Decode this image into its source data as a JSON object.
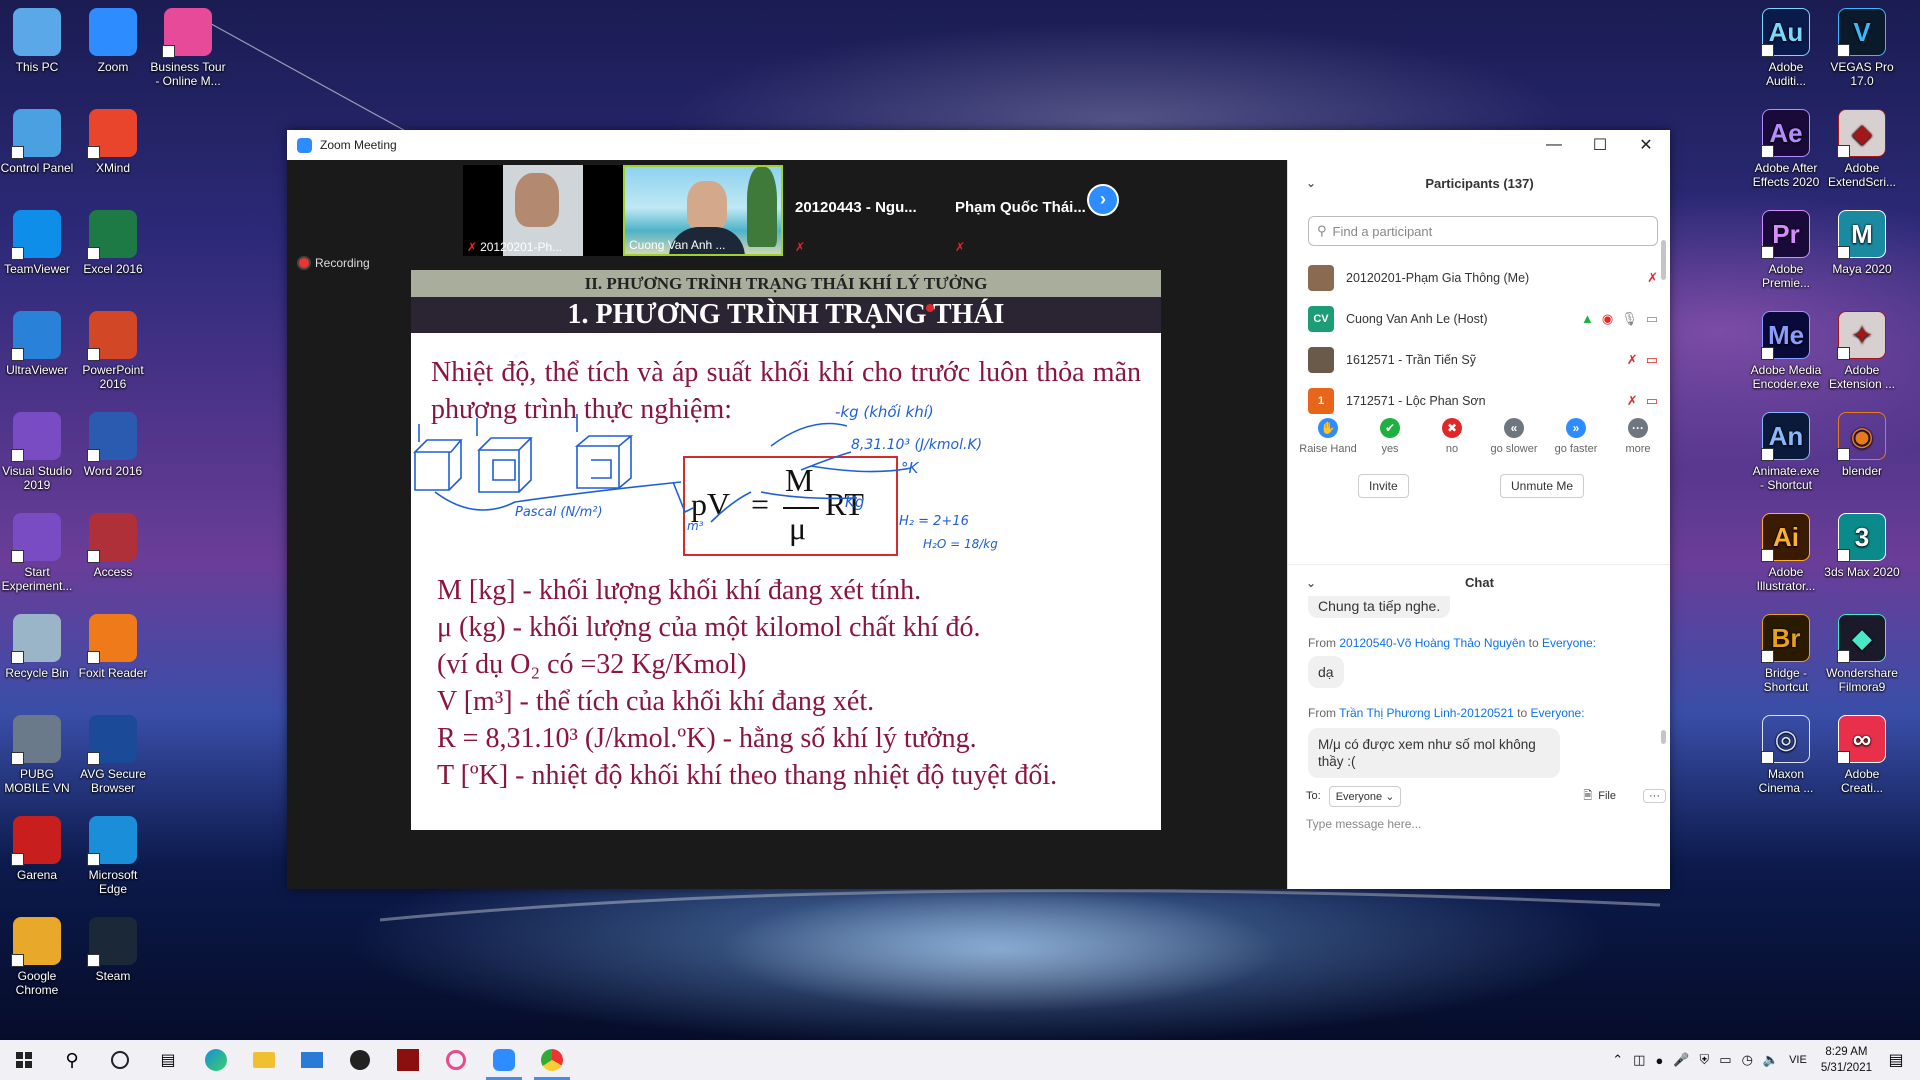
{
  "desktop": {
    "left_icons": [
      {
        "label": "This PC",
        "icon": "pc-icon",
        "color": "#5aa8e8"
      },
      {
        "label": "Zoom",
        "icon": "zoom-icon",
        "color": "#2d8cff"
      },
      {
        "label": "Business Tour\n- Online M...",
        "icon": "business-tour-icon",
        "color": "#e84a9a"
      },
      {
        "label": "Control Panel",
        "icon": "control-panel-icon",
        "color": "#4aa0e0"
      },
      {
        "label": "XMind",
        "icon": "xmind-icon",
        "color": "#e8452c"
      },
      {
        "label": "TeamViewer",
        "icon": "teamviewer-icon",
        "color": "#0e8ee9"
      },
      {
        "label": "Excel 2016",
        "icon": "excel-icon",
        "color": "#1d7a45"
      },
      {
        "label": "UltraViewer",
        "icon": "ultraviewer-icon",
        "color": "#2a82d8"
      },
      {
        "label": "PowerPoint\n2016",
        "icon": "powerpoint-icon",
        "color": "#d24726"
      },
      {
        "label": "Visual Studio\n2019",
        "icon": "visual-studio-icon",
        "color": "#7a4cc4"
      },
      {
        "label": "Word 2016",
        "icon": "word-icon",
        "color": "#2b5bb0"
      },
      {
        "label": "Start\nExperiment...",
        "icon": "visual-studio-icon",
        "color": "#7a4cc4"
      },
      {
        "label": "Access",
        "icon": "access-icon",
        "color": "#b0303a"
      },
      {
        "label": "Recycle Bin",
        "icon": "recycle-bin-icon",
        "color": "#9ab4c8"
      },
      {
        "label": "Foxit Reader",
        "icon": "foxit-icon",
        "color": "#ef7a1a"
      },
      {
        "label": "PUBG\nMOBILE VN",
        "icon": "pubg-icon",
        "color": "#6a7a8a"
      },
      {
        "label": "AVG Secure\nBrowser",
        "icon": "avg-icon",
        "color": "#1a4a98"
      },
      {
        "label": "Garena",
        "icon": "garena-icon",
        "color": "#c81e1e"
      },
      {
        "label": "Microsoft\nEdge",
        "icon": "edge-icon",
        "color": "#1a8ed8"
      },
      {
        "label": "Google\nChrome",
        "icon": "chrome-icon",
        "color": "#e8a82a"
      },
      {
        "label": "Steam",
        "icon": "steam-icon",
        "color": "#1b2838"
      }
    ],
    "right_icons": [
      {
        "label": "Adobe\nAuditi...",
        "glyph": "Au",
        "color": "#0a1a4a",
        "fg": "#7ad8ff"
      },
      {
        "label": "VEGAS Pro\n17.0",
        "glyph": "V",
        "color": "#0a1a2a",
        "fg": "#3ab8ff"
      },
      {
        "label": "Adobe After\nEffects 2020",
        "glyph": "Ae",
        "color": "#1a0a3a",
        "fg": "#b48cff"
      },
      {
        "label": "Adobe\nExtendScri...",
        "glyph": "◆",
        "color": "#d8d0d0",
        "fg": "#a01818"
      },
      {
        "label": "Adobe\nPremie...",
        "glyph": "Pr",
        "color": "#1a0a3a",
        "fg": "#d48cff"
      },
      {
        "label": "Maya 2020",
        "glyph": "M",
        "color": "#1a8aa0",
        "fg": "#ffffff"
      },
      {
        "label": "Adobe Media\nEncoder.exe",
        "glyph": "Me",
        "color": "#0a0a3a",
        "fg": "#8a9cff"
      },
      {
        "label": "Adobe\nExtension ...",
        "glyph": "✦",
        "color": "#d8d0d0",
        "fg": "#a01818"
      },
      {
        "label": "Animate.exe\n- Shortcut",
        "glyph": "An",
        "color": "#0a1a3a",
        "fg": "#8ab8ff"
      },
      {
        "label": "blender",
        "glyph": "◉",
        "color": "transparent",
        "fg": "#e87a1a"
      },
      {
        "label": "Adobe\nIllustrator...",
        "glyph": "Ai",
        "color": "#3a1a00",
        "fg": "#ffb02a"
      },
      {
        "label": "3ds Max 2020",
        "glyph": "3",
        "color": "#0a8a8a",
        "fg": "#ffffff"
      },
      {
        "label": "Bridge -\nShortcut",
        "glyph": "Br",
        "color": "#2a1a00",
        "fg": "#e8a01a"
      },
      {
        "label": "Wondershare\nFilmora9",
        "glyph": "◆",
        "color": "#1a1a2a",
        "fg": "#4ae8c8"
      },
      {
        "label": "Maxon\nCinema ...",
        "glyph": "◎",
        "color": "transparent",
        "fg": "#dde4f0"
      },
      {
        "label": "Adobe\nCreati...",
        "glyph": "∞",
        "color": "#e8304a",
        "fg": "#ffffff"
      }
    ]
  },
  "window": {
    "title": "Zoom Meeting",
    "recording": "Recording"
  },
  "gallery": {
    "tiles": [
      {
        "name": "20120201-Ph...",
        "muted": true
      },
      {
        "name": "Cuong Van Anh ...",
        "muted": false
      }
    ],
    "name_tiles": [
      {
        "name": "20120443 - Ngu...",
        "muted": true
      },
      {
        "name": "Phạm Quốc Thái...",
        "muted": true
      }
    ]
  },
  "slide": {
    "section": "II. PHƯƠNG TRÌNH TRẠNG THÁI KHÍ LÝ TƯỞNG",
    "heading": "1. PHƯƠNG TRÌNH TRẠNG THÁI",
    "intro": "Nhiệt độ, thể tích và áp suất khối khí cho trước luôn thỏa mãn phương trình thực nghiệm:",
    "formula": {
      "lhs": "pV",
      "eq": "=",
      "num": "M",
      "den": "μ",
      "rhs": "RT"
    },
    "lines": [
      "M [kg] - khối lượng khối khí đang xét tính.",
      "μ (kg)  - khối lượng của một kilomol chất khí đó.",
      "(ví dụ O₂ có =32 Kg/Kmol)",
      "V [m³] - thể tích của khối khí đang xét.",
      "R = 8,31.10³ (J/kmol.ºK) - hằng số khí lý tưởng.",
      "T [ºK] - nhiệt độ khối khí theo thang nhiệt độ tuyệt đối."
    ],
    "annotations": {
      "kg": "-kg (khối khí)",
      "r_value": "8,31.10³ (J/kmol.K)",
      "kelvin": "°K",
      "kg2": "Kg",
      "pascal": "Pascal (N/m²)",
      "m3": "m³",
      "h2": "H₂ = 2+16",
      "h2o": "H₂O = 18/kg"
    }
  },
  "participants": {
    "title": "Participants (137)",
    "search_placeholder": "Find a participant",
    "list": [
      {
        "name": "20120201-Phạm Gia Thông (Me)",
        "avatar": "photo",
        "avatar_color": "#8a6a50"
      },
      {
        "name": "Cuong Van Anh Le (Host)",
        "avatar": "CV",
        "avatar_color": "#1b9e77"
      },
      {
        "name": "1612571 - Trần Tiến Sỹ",
        "avatar": "photo",
        "avatar_color": "#6a5a4a"
      },
      {
        "name": "1712571 - Lộc Phan Sơn",
        "avatar": "1",
        "avatar_color": "#e8651a"
      }
    ],
    "reactions": [
      {
        "label": "Raise Hand",
        "icon": "raise-hand-icon",
        "color": "#2d8cff",
        "glyph": "✋"
      },
      {
        "label": "yes",
        "icon": "yes-icon",
        "color": "#1eb141",
        "glyph": "✔"
      },
      {
        "label": "no",
        "icon": "no-icon",
        "color": "#e02828",
        "glyph": "✖"
      },
      {
        "label": "go slower",
        "icon": "go-slower-icon",
        "color": "#6e7680",
        "glyph": "«"
      },
      {
        "label": "go faster",
        "icon": "go-faster-icon",
        "color": "#2d8cff",
        "glyph": "»"
      },
      {
        "label": "more",
        "icon": "more-icon",
        "color": "#6e7680",
        "glyph": "···"
      }
    ],
    "invite": "Invite",
    "unmute_me": "Unmute Me"
  },
  "chat": {
    "title": "Chat",
    "partial": "Chung ta tiếp nghe.",
    "messages": [
      {
        "from_label": "From",
        "sender": "20120540-Võ Hoàng Thảo Nguyên",
        "to_label": "to",
        "to": "Everyone:",
        "text": "dạ"
      },
      {
        "from_label": "From",
        "sender": "Trần Thị Phương Linh-20120521",
        "to_label": "to",
        "to": "Everyone:",
        "text": "M/μ có được xem như số mol không thầy :("
      }
    ],
    "to_label": "To:",
    "recipient": "Everyone",
    "file": "File",
    "placeholder": "Type message here..."
  },
  "taskbar": {
    "lang": "VIE",
    "time": "8:29 AM",
    "date": "5/31/2021"
  }
}
